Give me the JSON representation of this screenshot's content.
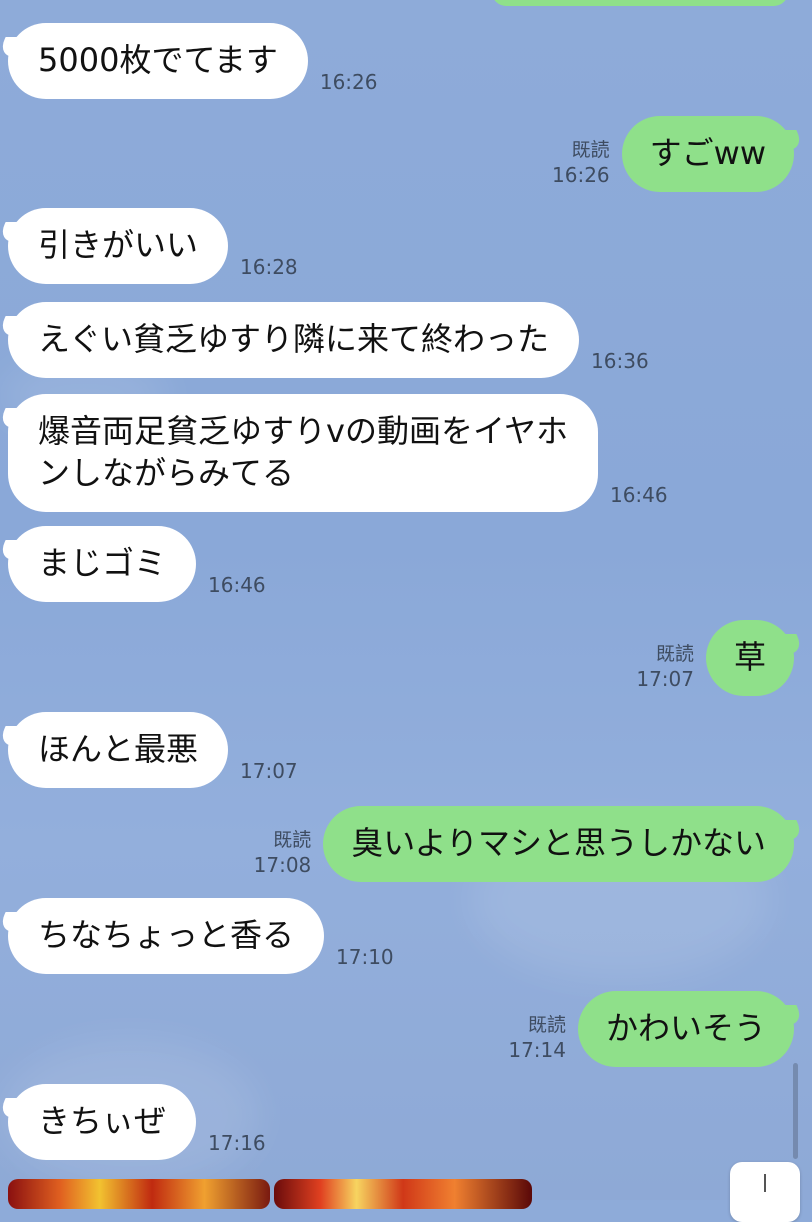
{
  "chat": {
    "messages": [
      {
        "side": "in",
        "lines": [
          "5000枚でてます"
        ],
        "time": "16:26"
      },
      {
        "side": "out",
        "lines": [
          "すごww"
        ],
        "read": "既読",
        "time": "16:26"
      },
      {
        "side": "in",
        "lines": [
          "引きがいい"
        ],
        "time": "16:28"
      },
      {
        "side": "in",
        "lines": [
          "えぐい貧乏ゆすり隣に来て終わった"
        ],
        "time": "16:36"
      },
      {
        "side": "in",
        "lines": [
          "爆音両足貧乏ゆすりvの動画をイヤホ",
          "ンしながらみてる"
        ],
        "time": "16:46"
      },
      {
        "side": "in",
        "lines": [
          "まじゴミ"
        ],
        "time": "16:46"
      },
      {
        "side": "out",
        "lines": [
          "草"
        ],
        "read": "既読",
        "time": "17:07"
      },
      {
        "side": "in",
        "lines": [
          "ほんと最悪"
        ],
        "time": "17:07"
      },
      {
        "side": "out",
        "lines": [
          "臭いよりマシと思うしかない"
        ],
        "read": "既読",
        "time": "17:08"
      },
      {
        "side": "in",
        "lines": [
          "ちなちょっと香る"
        ],
        "time": "17:10"
      },
      {
        "side": "out",
        "lines": [
          "かわいそう"
        ],
        "read": "既読",
        "time": "17:14"
      },
      {
        "side": "in",
        "lines": [
          "きちぃぜ"
        ],
        "time": "17:16"
      }
    ]
  },
  "colors": {
    "background": "#8eabd9",
    "incoming_bubble": "#ffffff",
    "outgoing_bubble": "#8fe08a",
    "timestamp_text": "#3e4c61"
  },
  "icons": {
    "scroll_down": "arrow-down-icon"
  }
}
